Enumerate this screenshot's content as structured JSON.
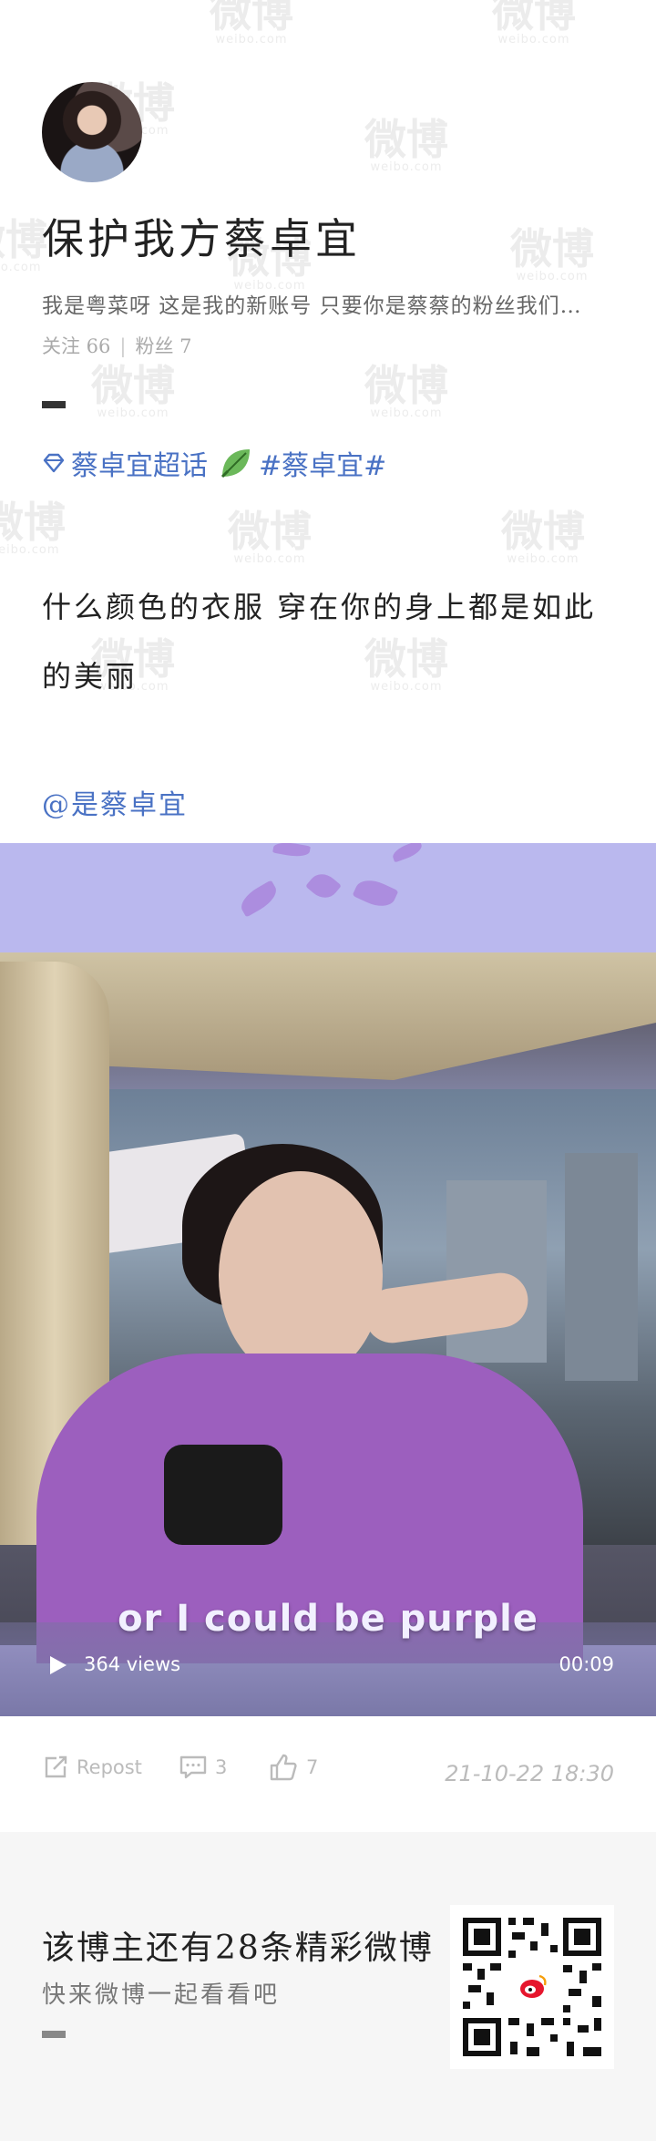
{
  "profile": {
    "name": "保护我方蔡卓宜",
    "bio": "我是粤菜呀 这是我的新账号 只要你是蔡蔡的粉丝我们…",
    "following_label": "关注 66",
    "followers_label": "粉丝 7"
  },
  "topics": {
    "super_topic": "蔡卓宜超话",
    "hashtag": "#蔡卓宜#"
  },
  "post": {
    "text": "什么颜色的衣服 穿在你的身上都是如此的美丽",
    "mention": "@是蔡卓宜"
  },
  "video": {
    "subtitle": "or I could be purple",
    "views": "364 views",
    "duration": "00:09"
  },
  "actions": {
    "repost": "Repost",
    "comments": "3",
    "likes": "7",
    "timestamp": "21-10-22 18:30"
  },
  "footer": {
    "title": "该博主还有28条精彩微博",
    "subtitle": "快来微博一起看看吧"
  },
  "watermark": {
    "brand": "微博",
    "domain": "weibo.com"
  },
  "colors": {
    "link": "#4a72c4",
    "video_bg": "#b8b6ea"
  }
}
